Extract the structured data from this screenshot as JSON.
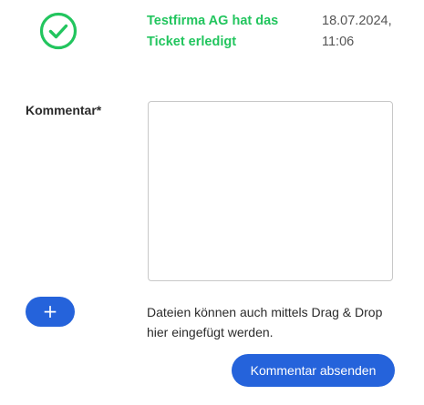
{
  "status": {
    "icon": "check-circle-icon",
    "color": "#22c55e",
    "message_line1": "Testfirma AG hat das",
    "message_line2": "Ticket erledigt",
    "date": "18.07.2024,",
    "time": "11:06"
  },
  "comment": {
    "label": "Kommentar*",
    "value": ""
  },
  "attachments": {
    "add_button_label": "+",
    "add_button_icon": "plus-icon",
    "hint_line1": "Dateien können auch mittels Drag & Drop",
    "hint_line2": "hier eingefügt werden."
  },
  "actions": {
    "submit_label": "Kommentar absenden",
    "accent_color": "#2563db"
  }
}
